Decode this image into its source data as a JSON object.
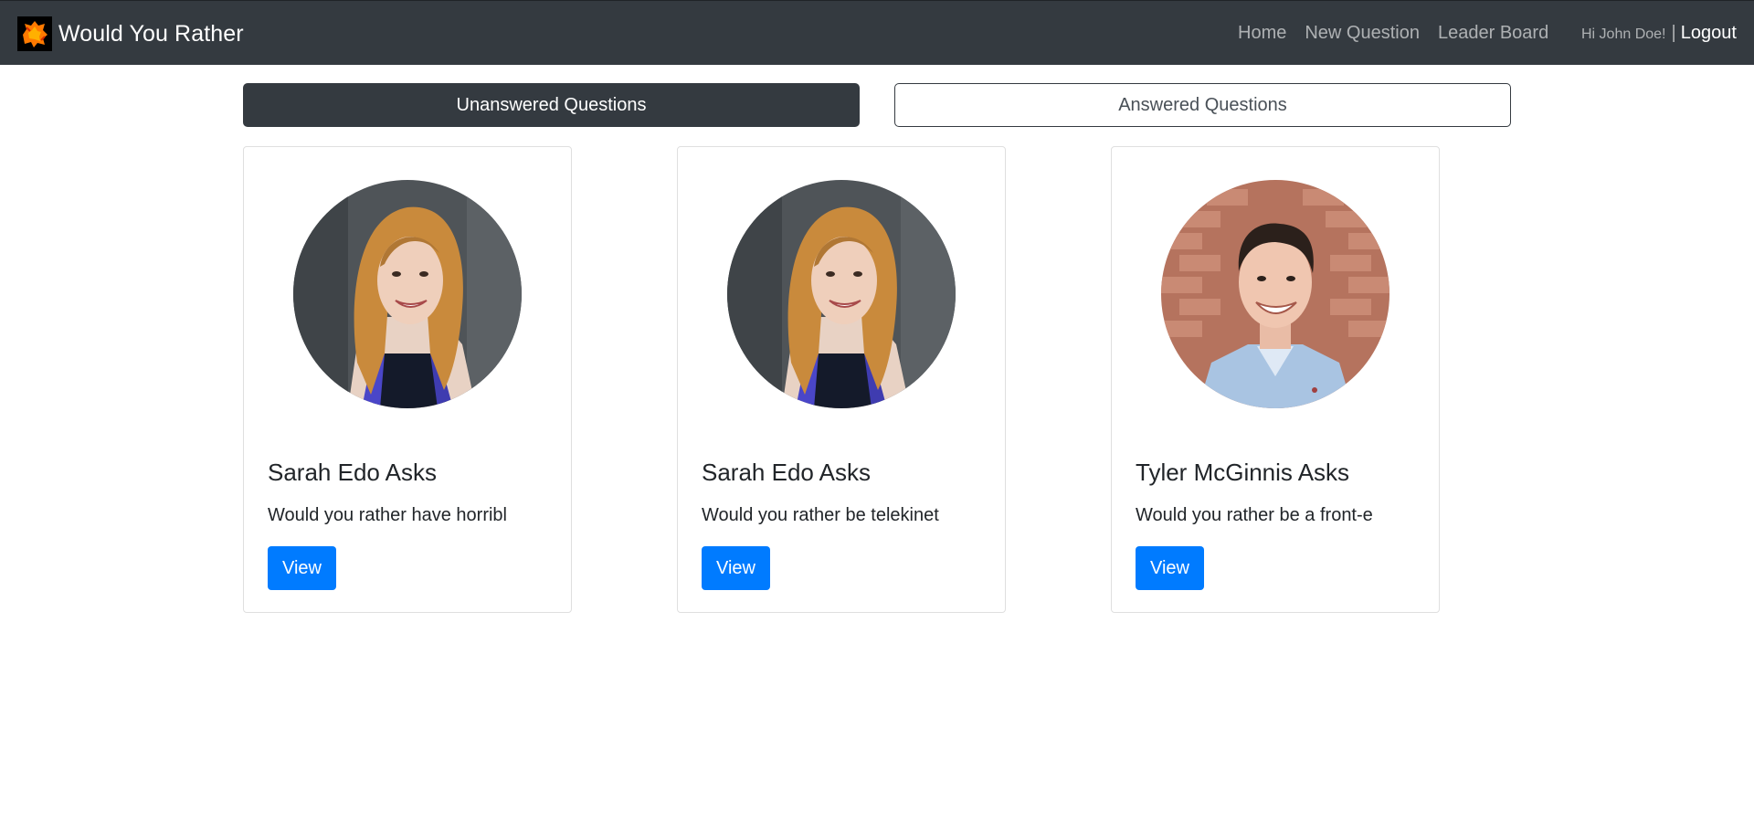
{
  "navbar": {
    "brand": "Would You Rather",
    "links": [
      "Home",
      "New Question",
      "Leader Board"
    ],
    "greeting": "Hi John Doe!",
    "separator": "|",
    "logout": "Logout"
  },
  "tabs": {
    "unanswered": "Unanswered Questions",
    "answered": "Answered Questions",
    "active": "unanswered"
  },
  "questions": [
    {
      "author": "Sarah Edo Asks",
      "preview": "Would you rather have horribl",
      "button": "View",
      "avatar": "woman-portrait"
    },
    {
      "author": "Sarah Edo Asks",
      "preview": "Would you rather be telekinet",
      "button": "View",
      "avatar": "woman-portrait"
    },
    {
      "author": "Tyler McGinnis Asks",
      "preview": "Would you rather be a front-e",
      "button": "View",
      "avatar": "man-portrait"
    }
  ],
  "colors": {
    "navbar": "#343a40",
    "primary": "#007bff"
  }
}
